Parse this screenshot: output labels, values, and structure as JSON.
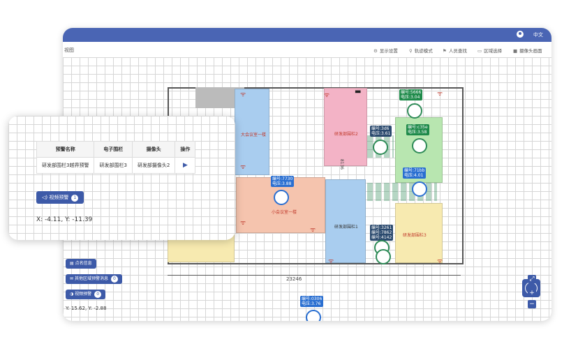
{
  "header": {
    "language": "中文"
  },
  "toolbar": {
    "title": "视图",
    "items": [
      {
        "label": "显示设置",
        "icon": "gear-icon"
      },
      {
        "label": "轨迹模式",
        "icon": "pin-icon"
      },
      {
        "label": "人员查找",
        "icon": "flag-icon"
      },
      {
        "label": "区域选择",
        "icon": "select-icon"
      },
      {
        "label": "摄像头画面",
        "icon": "camera-icon"
      }
    ]
  },
  "map": {
    "rooms": [
      {
        "label": "大会议室一楼"
      },
      {
        "label": "小会议室一楼"
      },
      {
        "label": "研发部围栏2"
      },
      {
        "label": "研发部围栏1"
      },
      {
        "label": "研发部围栏3"
      }
    ],
    "tags": [
      {
        "label": "编号:5666",
        "sub": "电压:3.04"
      },
      {
        "label": "编号:3d6",
        "sub": "电压:3.61"
      },
      {
        "label": "编号:c35e",
        "sub": "电压:3.58"
      },
      {
        "label": "编号:71bb",
        "sub": "电压:4.01"
      },
      {
        "label": "编号:7730",
        "sub": "电压:3.88"
      },
      {
        "label": "编号:3261",
        "sub": "编号:7862"
      },
      {
        "label": "编号:4142",
        "sub": ""
      },
      {
        "label": "编号:0306",
        "sub": "电压:3.76"
      }
    ],
    "dimension": "23246",
    "scale_side": "8136",
    "colors": {
      "blue_room": "#a9cdef",
      "red_room": "#f3b3c6",
      "orange_room": "#f5c4ae",
      "green_room": "#b8e6b0",
      "yellow_room": "#f7eab0"
    }
  },
  "popup": {
    "table": {
      "headers": [
        "预警名称",
        "电子围栏",
        "摄像头",
        "操作"
      ],
      "rows": [
        [
          "研发部围栏3越界预警",
          "研发部围栏3",
          "研发部摄像头2",
          ""
        ]
      ]
    },
    "video_button": {
      "label": "视频预警",
      "count": "1"
    },
    "coords": "X: -4.11, Y: -11.39"
  },
  "side": {
    "buttons": [
      {
        "label": "点名信息",
        "count": ""
      },
      {
        "label": "其他区域预警消息",
        "count": "0"
      },
      {
        "label": "视频预警",
        "count": "0"
      }
    ],
    "coords": "Y: 15.62, Y: -2.88"
  }
}
